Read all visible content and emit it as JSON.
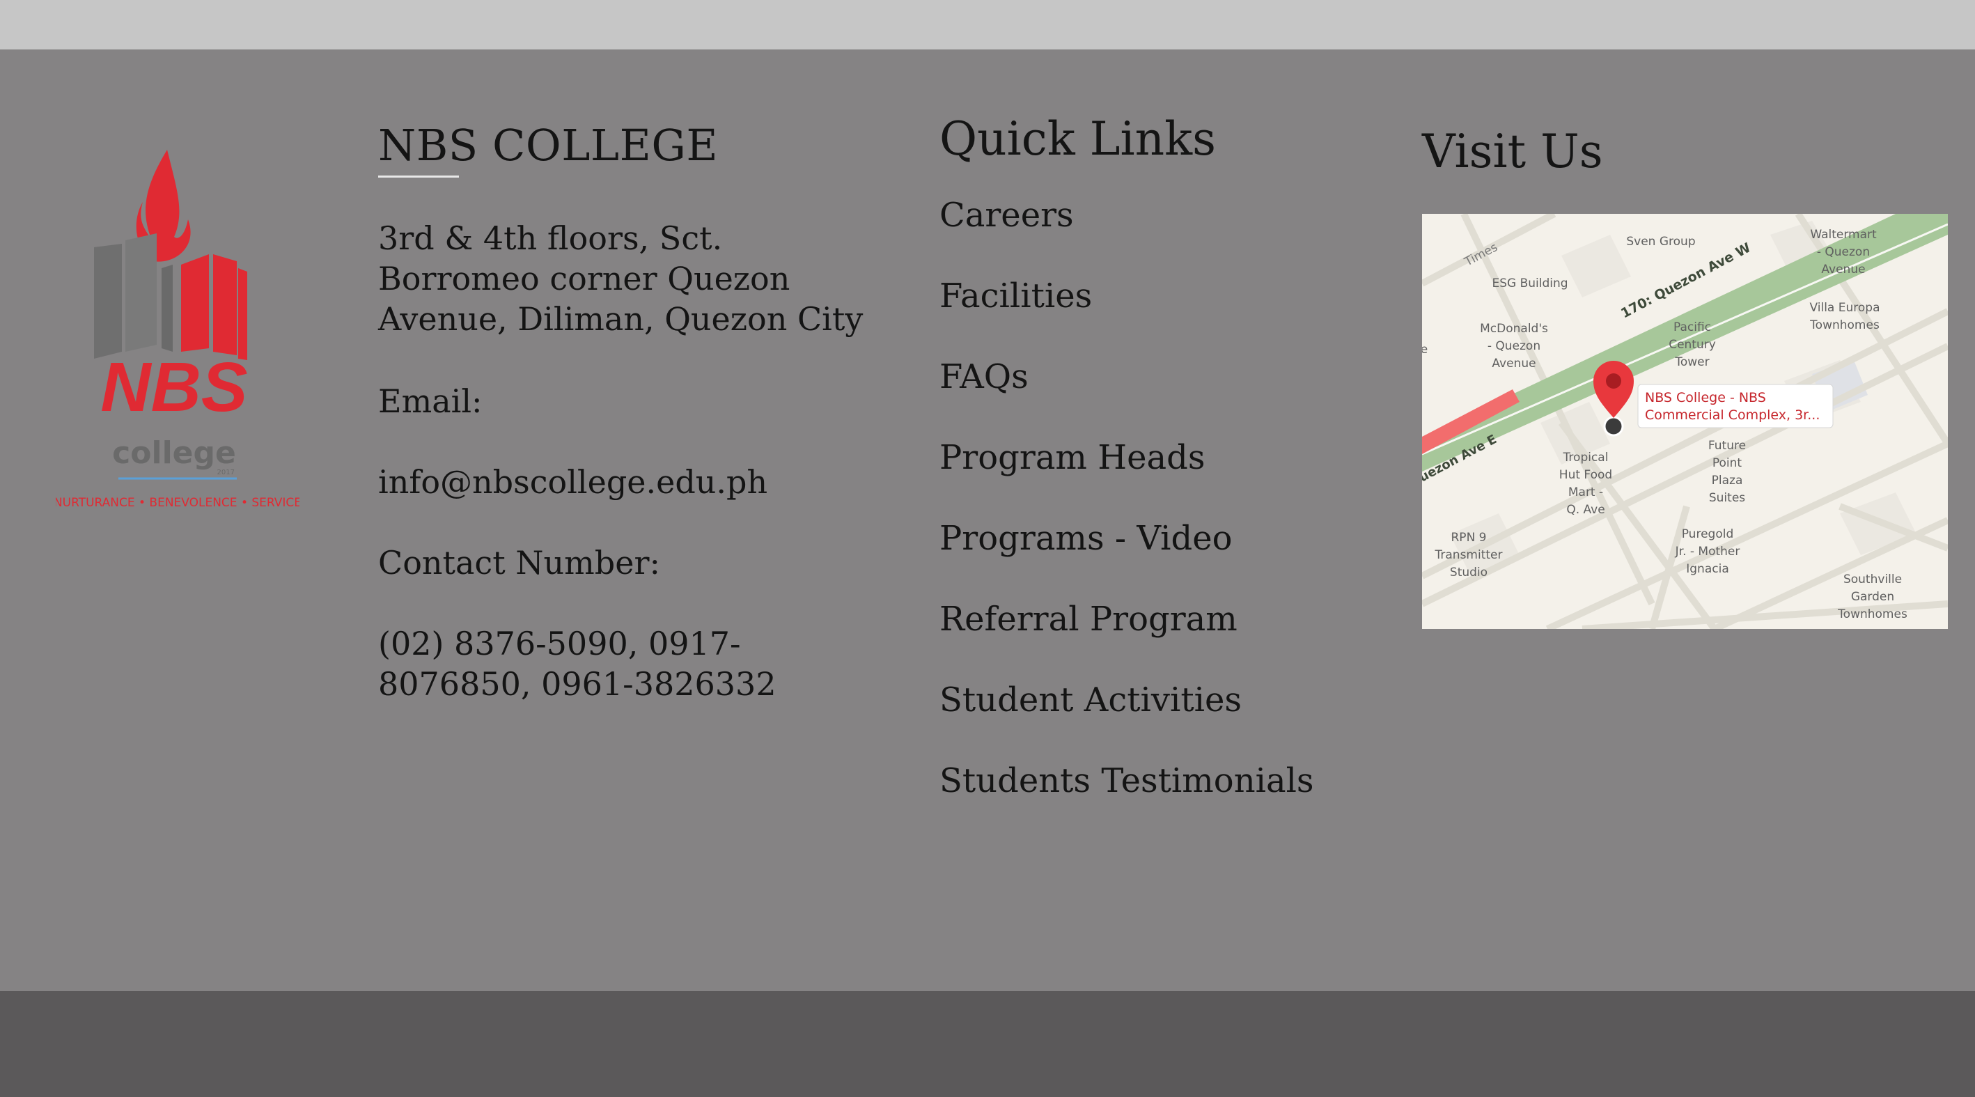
{
  "logo": {
    "brand": "NBS",
    "sub": "college",
    "year": "2017",
    "tagline": "NURTURANCE • BENEVOLENCE • SERVICE"
  },
  "college": {
    "title": "NBS COLLEGE",
    "address": "3rd & 4th floors, Sct. Borromeo corner Quezon Avenue, Diliman, Quezon City",
    "email_label": "Email:",
    "email": "info@nbscollege.edu.ph",
    "contact_label": "Contact Number:",
    "contact": "(02) 8376-5090, 0917-8076850, 0961-3826332"
  },
  "quick_links": {
    "title": "Quick Links",
    "items": [
      "Careers",
      "Facilities",
      "FAQs",
      "Program Heads",
      "Programs - Video",
      "Referral Program",
      "Student Activities",
      "Students Testimonials"
    ]
  },
  "visit": {
    "title": "Visit Us",
    "map": {
      "marker_label_line1": "NBS College - NBS",
      "marker_label_line2": "Commercial Complex, 3r...",
      "road_main": "170: Quezon Ave W",
      "road_east": "uezon Ave E",
      "road_times": "Times",
      "labels": {
        "sven": "Sven Group",
        "waltermart_1": "Waltermart",
        "waltermart_2": "- Quezon",
        "waltermart_3": "Avenue",
        "esg": "ESG Building",
        "villa_1": "Villa Europa",
        "villa_2": "Townhomes",
        "mcd_1": "McDonald's",
        "mcd_2": "- Quezon",
        "mcd_3": "Avenue",
        "pacific_1": "Pacific",
        "pacific_2": "Century",
        "pacific_3": "Tower",
        "future_1": "Future",
        "future_2": "Point",
        "future_3": "Plaza",
        "future_4": "Suites",
        "tropical_1": "Tropical",
        "tropical_2": "Hut Food",
        "tropical_3": "Mart -",
        "tropical_4": "Q. Ave",
        "rpn_1": "RPN 9",
        "rpn_2": "Transmitter",
        "rpn_3": "Studio",
        "puregold_1": "Puregold",
        "puregold_2": "Jr. - Mother",
        "puregold_3": "Ignacia",
        "south_1": "Southville",
        "south_2": "Garden",
        "south_3": "Townhomes",
        "edge_e": "e"
      }
    }
  },
  "colors": {
    "top_bar": "#c6c6c6",
    "footer_bg": "#858384",
    "bottom_bar": "#5b595a",
    "logo_red": "#e02a33",
    "map_road_green": "#a7c79a",
    "marker_red": "#e8383d"
  }
}
